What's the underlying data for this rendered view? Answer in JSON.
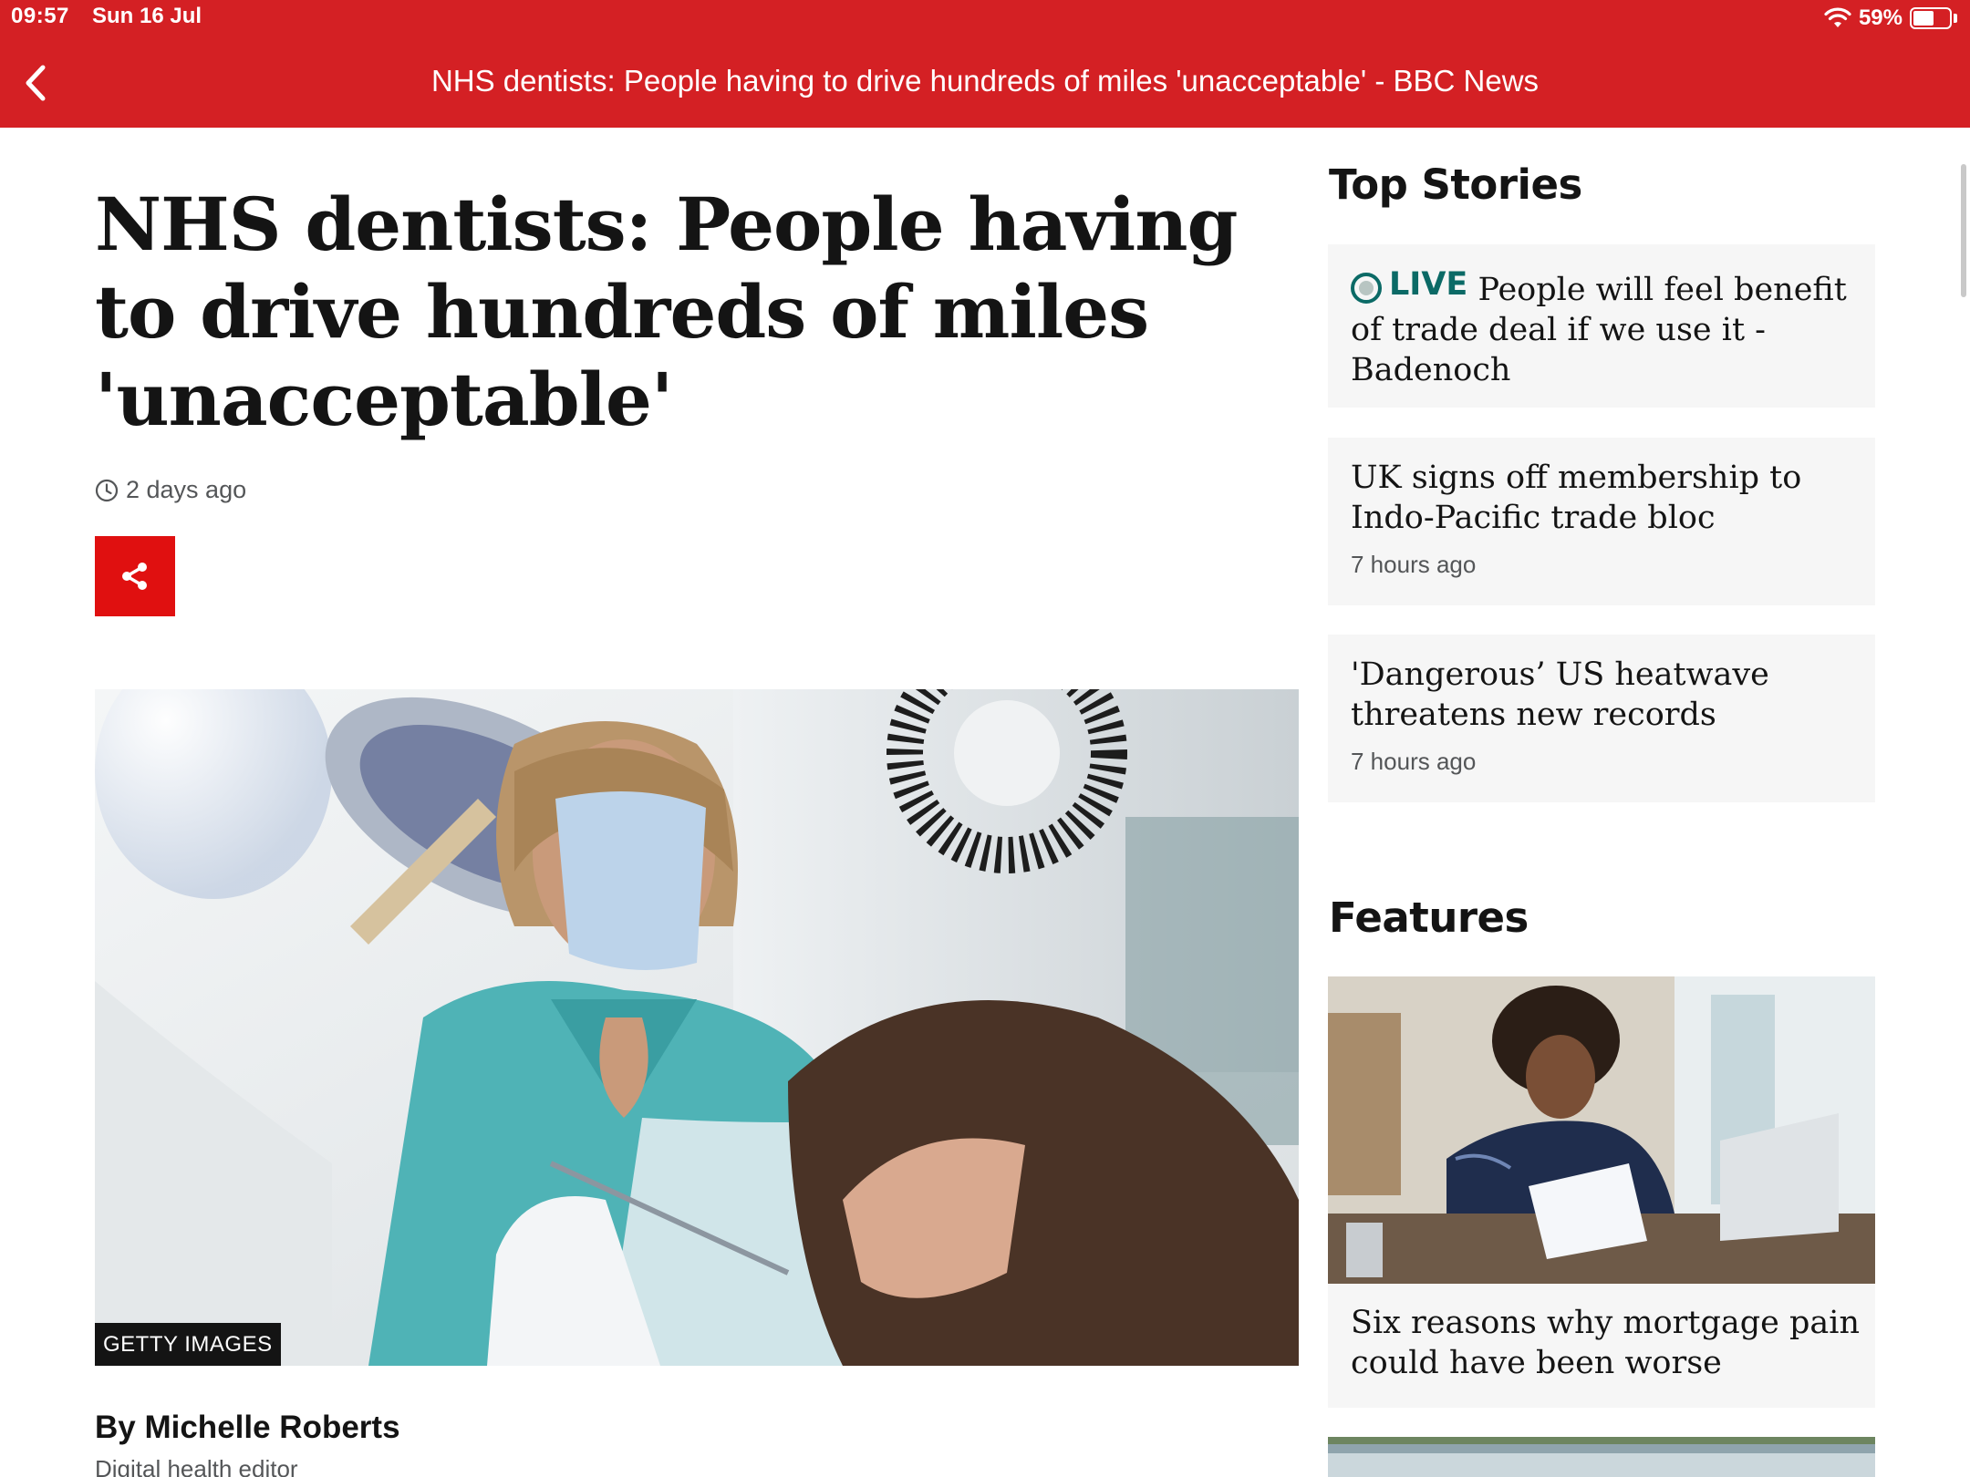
{
  "status_bar": {
    "time": "09:57",
    "date": "Sun 16 Jul",
    "battery": "59%",
    "battery_level": 0.59
  },
  "nav": {
    "back_icon": "chevron-left-icon",
    "title": "NHS dentists: People having to drive hundreds of miles 'unacceptable' - BBC News"
  },
  "article": {
    "headline_line1": "NHS dentists: People having",
    "headline_line2": "to drive hundreds of miles",
    "headline_line3": "'unacceptable'",
    "timestamp": "2 days ago",
    "share_icon": "share-icon",
    "image_credit": "GETTY IMAGES",
    "byline": "By Michelle Roberts",
    "role": "Digital health editor"
  },
  "top_stories": {
    "heading": "Top Stories",
    "live_label": "LIVE",
    "items": [
      {
        "title": "People will feel benefit of trade deal if we use it - Badenoch",
        "time": ""
      },
      {
        "title": "UK signs off membership to Indo-Pacific trade bloc",
        "time": "7 hours ago"
      },
      {
        "title": "'Dangerous’ US heatwave threatens new records",
        "time": "7 hours ago"
      }
    ]
  },
  "features": {
    "heading": "Features",
    "items": [
      {
        "title": "Six reasons why mortgage pain could have been worse"
      }
    ]
  },
  "colors": {
    "brand_red": "#d42024",
    "share_red": "#e01010",
    "live_teal": "#0b6a66",
    "card_bg": "#f6f6f6"
  }
}
